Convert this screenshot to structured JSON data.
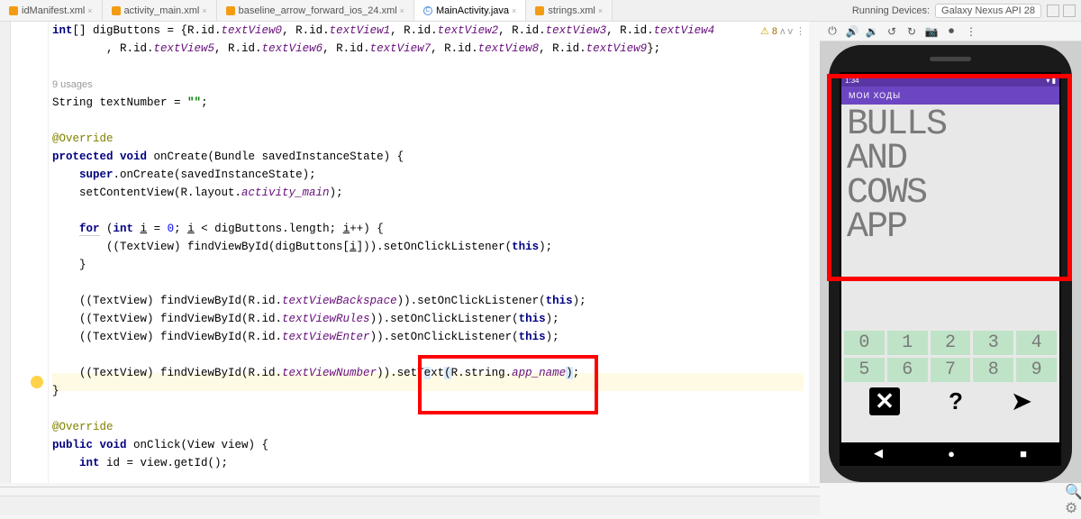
{
  "tabs": {
    "t0": "idManifest.xml",
    "t1": "activity_main.xml",
    "t2": "baseline_arrow_forward_ios_24.xml",
    "t3": "MainActivity.java",
    "t4": "strings.xml"
  },
  "running_label": "Running Devices:",
  "device": "Galaxy Nexus API 28",
  "warn": {
    "count": "8"
  },
  "code": {
    "l1a": "int",
    "l1b": "[] digButtons = {R.id.",
    "l1_tv0": "textView0",
    "l1_sep": ", R.id.",
    "l1_tv1": "textView1",
    "l1_tv2": "textView2",
    "l1_tv3": "textView3",
    "l1_tv4": "textView4",
    "l1c": "        , R.id.",
    "l1_tv5": "textView5",
    "l1_tv6": "textView6",
    "l1_tv7": "textView7",
    "l1_tv8": "textView8",
    "l1_tv9": "textView9",
    "l1d": "};",
    "usages": "9 usages",
    "l3a": "String ",
    "l3b": "textNumber",
    "l3c": " = ",
    "l3d": "\"\"",
    "l3e": ";",
    "override": "@Override",
    "l5a": "protected void",
    "l5b": " onCreate(Bundle savedInstanceState) {",
    "l6a": "    ",
    "l6b": "super",
    "l6c": ".onCreate(savedInstanceState);",
    "l7a": "    setContentView(R.layout.",
    "l7b": "activity_main",
    "l7c": ");",
    "l9a": "    ",
    "l9for": "for",
    "l9b": " (",
    "l9int": "int",
    "l9c": " ",
    "l9i1": "i",
    "l9d": " = ",
    "l9zero": "0",
    "l9e": "; ",
    "l9i2": "i",
    "l9f": " < digButtons.length; ",
    "l9i3": "i",
    "l9g": "++) {",
    "l10a": "        ((TextView) findViewById(digButtons[",
    "l10i": "i",
    "l10b": "])).setOnClickListener(",
    "l10this": "this",
    "l10c": ");",
    "l11": "    }",
    "l13a": "    ((TextView) findViewById(R.id.",
    "l13b": "textViewBackspace",
    "l13c": ")).setOnClickListener(",
    "l13this": "this",
    "l13d": ");",
    "l14b": "textViewRules",
    "l15b": "textViewEnter",
    "l17a": "    ((TextView) findViewById(R.id.",
    "l17b": "textViewNumber",
    "l17c": ")).setT",
    "l17sel1": "e",
    "l17mid": "xt",
    "l17sel2": "(",
    "l17d": "R.string.",
    "l17e": "app_name",
    "l17sel3": ")",
    "l17f": ";",
    "l18": "}",
    "l21a": "public void",
    "l21b": " onClick(View view) {",
    "l22a": "    ",
    "l22b": "int",
    "l22c": " id = view.getId();"
  },
  "emu": {
    "time": "1:34",
    "app_title": "МОИ ХОДЫ",
    "d1": "BULLS",
    "d2": "AND",
    "d3": "COWS",
    "d4": "APP",
    "k0": "0",
    "k1": "1",
    "k2": "2",
    "k3": "3",
    "k4": "4",
    "k5": "5",
    "k6": "6",
    "k7": "7",
    "k8": "8",
    "k9": "9",
    "bx": "✕",
    "bq": "?",
    "ba": "➤"
  }
}
